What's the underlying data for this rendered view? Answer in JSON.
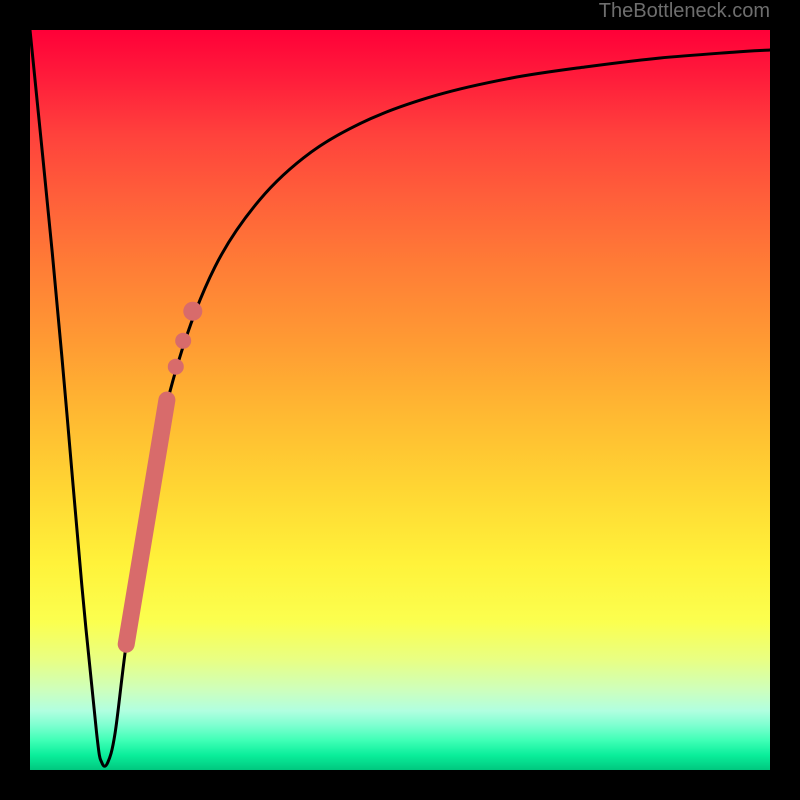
{
  "watermark": "TheBottleneck.com",
  "colors": {
    "curve_stroke": "#000000",
    "marker_fill": "#d86b6b",
    "background": "#000000"
  },
  "chart_data": {
    "type": "line",
    "title": "",
    "xlabel": "",
    "ylabel": "",
    "xlim": [
      0,
      100
    ],
    "ylim": [
      0,
      100
    ],
    "series": [
      {
        "name": "bottleneck-curve",
        "x": [
          0,
          3,
          5,
          7,
          9,
          9.7,
          10.5,
          11.5,
          13,
          16,
          20,
          25,
          31,
          38,
          46,
          55,
          65,
          75,
          85,
          95,
          100
        ],
        "values": [
          100,
          70,
          48,
          25,
          5,
          1,
          1,
          5,
          17,
          38,
          55,
          68,
          77,
          83.5,
          88,
          91.2,
          93.5,
          95,
          96.2,
          97,
          97.3
        ]
      }
    ],
    "markers": [
      {
        "name": "highlight-band-start",
        "x": 13.0,
        "y": 17
      },
      {
        "name": "highlight-band-end",
        "x": 18.5,
        "y": 50
      },
      {
        "name": "dot-a",
        "x": 19.7,
        "y": 54.5
      },
      {
        "name": "dot-b",
        "x": 20.7,
        "y": 58
      },
      {
        "name": "dot-c",
        "x": 22.0,
        "y": 62
      }
    ]
  }
}
